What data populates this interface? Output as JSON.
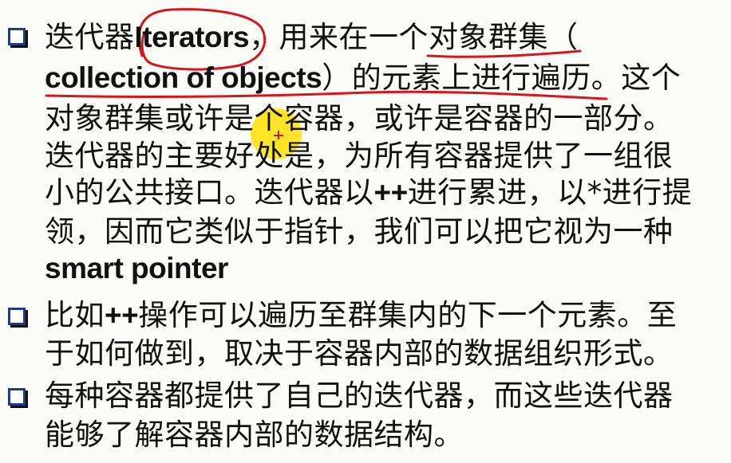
{
  "bullets": [
    {
      "lines": [
        {
          "pre": "迭代器",
          "en": "Iterators",
          "post": "，用来在一个对象群集（"
        },
        {
          "en": "collection of objects",
          "post": "）的元素上进行遍历。这个"
        },
        {
          "post": "对象群集或许是个容器，或许是容器的一部分。"
        },
        {
          "post": "迭代器的主要好处是，为所有容器提供了一组很"
        },
        {
          "pre": "小的公共接口。迭代器以",
          "en": "++",
          "post": "进行累进，以*进行提"
        },
        {
          "post": "领，因而它类似于指针，我们可以把它视为一种"
        },
        {
          "en": "smart pointer"
        }
      ]
    },
    {
      "lines": [
        {
          "pre": "比如",
          "en": "++",
          "post": "操作可以遍历至群集内的下一个元素。至"
        },
        {
          "post": "于如何做到，取决于容器内部的数据组织形式。"
        }
      ]
    },
    {
      "lines": [
        {
          "post": "每种容器都提供了自己的迭代器，而这些迭代器"
        },
        {
          "post": "能够了解容器内部的数据结构。"
        }
      ]
    }
  ],
  "colors": {
    "checkbox": "#1f3a8a",
    "annotation": "#d8151c",
    "highlight": "#ffe000"
  }
}
